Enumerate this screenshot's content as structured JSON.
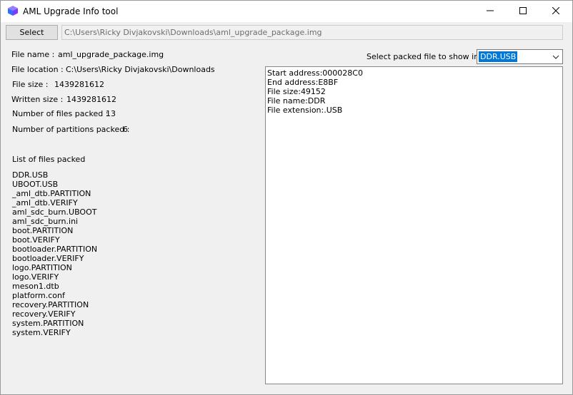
{
  "window": {
    "title": "AML Upgrade Info tool"
  },
  "toolbar": {
    "select_label": "Select",
    "path_value": "C:\\Users\\Ricky Divjakovski\\Downloads\\aml_upgrade_package.img"
  },
  "info": {
    "file_name_label": "File name :",
    "file_name_value": "aml_upgrade_package.img",
    "file_location_label": "File location :",
    "file_location_value": "C:\\Users\\Ricky Divjakovski\\Downloads",
    "file_size_label": "File size :",
    "file_size_value": "1439281612",
    "written_size_label": "Written size :",
    "written_size_value": "1439281612",
    "files_packed_label": "Number of files packed :",
    "files_packed_value": "13",
    "partitions_packed_label": "Number of partitions packed :",
    "partitions_packed_value": "6"
  },
  "files": {
    "header": "List of files packed",
    "items": [
      "DDR.USB",
      "UBOOT.USB",
      "_aml_dtb.PARTITION",
      "_aml_dtb.VERIFY",
      "aml_sdc_burn.UBOOT",
      "aml_sdc_burn.ini",
      "boot.PARTITION",
      "boot.VERIFY",
      "bootloader.PARTITION",
      "bootloader.VERIFY",
      "logo.PARTITION",
      "logo.VERIFY",
      "meson1.dtb",
      "platform.conf",
      "recovery.PARTITION",
      "recovery.VERIFY",
      "system.PARTITION",
      "system.VERIFY"
    ]
  },
  "selector": {
    "label": "Select packed file to show info",
    "selected": "DDR.USB"
  },
  "details": {
    "lines": [
      "Start address:000028C0",
      "End address:E8BF",
      "File size:49152",
      "File name:DDR",
      "File extension:.USB"
    ]
  },
  "colors": {
    "accent": "#0078d7",
    "window_bg": "#f0f0f0"
  }
}
